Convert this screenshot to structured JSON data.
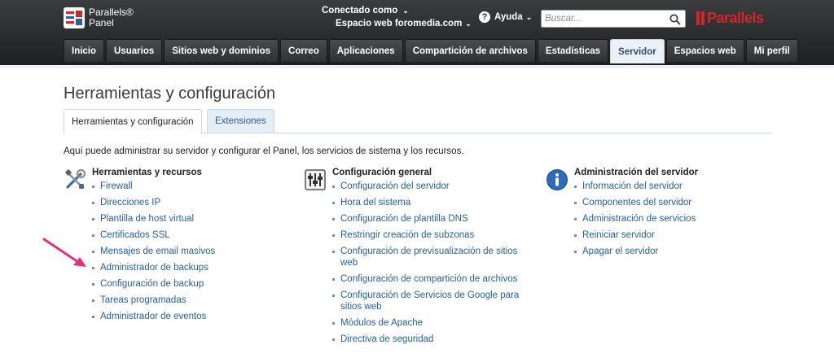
{
  "header": {
    "logo_line1": "Parallels®",
    "logo_line2": "Panel",
    "connected_label": "Conectado como",
    "webspace_label": "Espacio web foromedia.com",
    "help_label": "Ayuda",
    "search_placeholder": "Buscar...",
    "brand": "Parallels"
  },
  "nav": {
    "items": [
      {
        "label": "Inicio"
      },
      {
        "label": "Usuarios"
      },
      {
        "label": "Sitios web y dominios"
      },
      {
        "label": "Correo"
      },
      {
        "label": "Aplicaciones"
      },
      {
        "label": "Compartición de archivos"
      },
      {
        "label": "Estadísticas"
      },
      {
        "label": "Servidor"
      },
      {
        "label": "Espacios web"
      },
      {
        "label": "Mi perfil"
      }
    ],
    "active": "Servidor"
  },
  "page": {
    "title": "Herramientas y configuración",
    "tabs": [
      {
        "label": "Herramientas y configuración"
      },
      {
        "label": "Extensiones"
      }
    ],
    "intro": "Aquí puede administrar su servidor y configurar el Panel, los servicios de sistema y los recursos."
  },
  "sections": [
    {
      "title": "Herramientas y recursos",
      "icon": "tools-icon",
      "links": [
        "Firewall",
        "Direcciones IP",
        "Plantilla de host virtual",
        "Certificados SSL",
        "Mensajes de email masivos",
        "Administrador de backups",
        "Configuración de backup",
        "Tareas programadas",
        "Administrador de eventos"
      ]
    },
    {
      "title": "Configuración general",
      "icon": "sliders-icon",
      "links": [
        "Configuración del servidor",
        "Hora del sistema",
        "Configuración de plantilla DNS",
        "Restringir creación de subzonas",
        "Configuración de previsualización de sitios web",
        "Configuración de compartición de archivos",
        "Configuración de Servicios de Google para sitios web",
        "Módulos de Apache",
        "Directiva de seguridad"
      ]
    },
    {
      "title": "Administración del servidor",
      "icon": "info-icon",
      "links": [
        "Información del servidor",
        "Componentes del servidor",
        "Administración de servicios",
        "Reiniciar servidor",
        "Apagar el servidor"
      ]
    }
  ],
  "colors": {
    "header_bg": "#2b2c2e",
    "link": "#245fa3",
    "brand_red": "#d0262d",
    "active_tab_bg": "#ebf1f6",
    "arrow": "#e8307a"
  }
}
